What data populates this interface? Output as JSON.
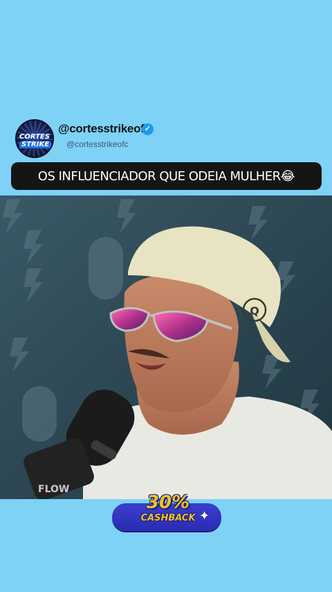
{
  "profile": {
    "username": "@cortesstrikeofc",
    "handle": "@cortesstrikeofc",
    "avatar_line1": "CORTES",
    "avatar_line2": "STRIKE",
    "verified_icon": "verified-check-icon"
  },
  "caption": {
    "text": "OS INFLUENCIADOR QUE ODEIA MULHER😂"
  },
  "video": {
    "description_icon": "video-frame"
  },
  "promo": {
    "percent": "30%",
    "label": "CASHBACK",
    "icon": "sparkle-icon"
  },
  "colors": {
    "background": "#7dd2f6",
    "caption_bg": "#151515",
    "promo_blue": "#2a2cb0",
    "promo_yellow": "#f5c21b"
  }
}
